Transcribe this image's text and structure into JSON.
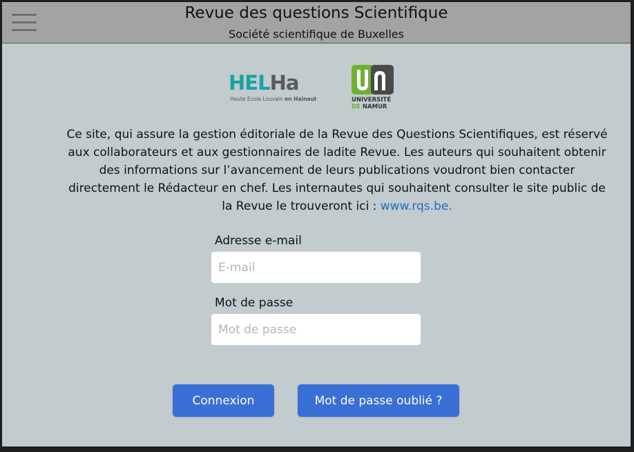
{
  "header": {
    "menu_icon": "hamburger-menu-icon",
    "title": "Revue des questions Scientifique",
    "subtitle": "Société scientifique de Buxelles",
    "background_color": "#a3a3a3"
  },
  "logos": {
    "helha": {
      "word_part1": "HEL",
      "word_part2": "Ha",
      "tagline_part1": "Haute École Louvain",
      "tagline_part2": "en Hainaut",
      "teal_color": "#1aa3a3"
    },
    "unamur": {
      "line1": "UNIVERSITÉ",
      "line2_part1": "DE",
      "line2_part2": "NAMUR",
      "green_color": "#6db22e"
    }
  },
  "intro": {
    "text": "Ce site, qui assure la gestion éditoriale de la Revue des Questions Scientifiques, est réservé aux collaborateurs et aux gestionnaires de ladite Revue. Les auteurs qui souhaitent obtenir des informations sur l’avancement de leurs publications voudront bien contacter directement le Rédacteur en chef. Les internautes qui souhaitent consulter le site public de la Revue le trouveront ici : ",
    "link_text": "www.rqs.be."
  },
  "form": {
    "email_label": "Adresse e-mail",
    "email_placeholder": "E-mail",
    "email_value": "",
    "password_label": "Mot de passe",
    "password_placeholder": "Mot de passe",
    "password_value": "",
    "login_button": "Connexion",
    "forgot_button": "Mot de passe oublié ?",
    "button_color": "#3a6fd6"
  },
  "page_background": "#c2cbce"
}
